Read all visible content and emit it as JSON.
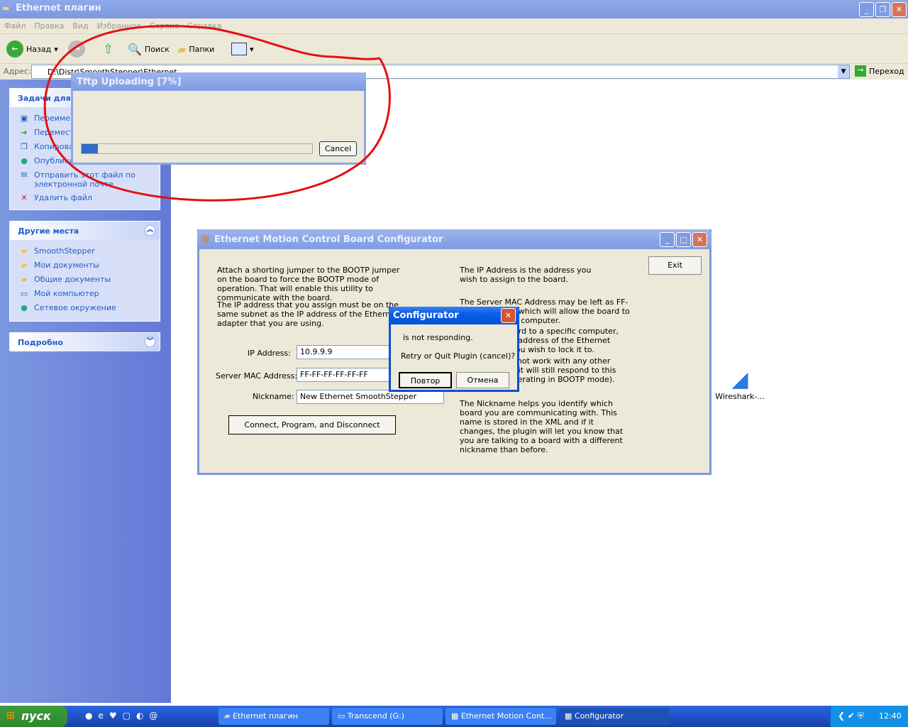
{
  "explorer": {
    "title": "Ethernet плагин",
    "menu": [
      "Файл",
      "Правка",
      "Вид",
      "Избранное",
      "Сервис",
      "Справка"
    ],
    "toolbar": {
      "back": "Назад",
      "search": "Поиск",
      "folders": "Папки"
    },
    "address_label": "Адрес:",
    "address_value": "D:\\Distr\\SmoothStepper\\Ethernet",
    "go": "Переход"
  },
  "sidebar": {
    "tasks_title": "Задачи для файла",
    "tasks": [
      "Переименовать файл",
      "Переместить файл",
      "Копировать файл",
      "Опубликовать файл в вебе",
      "Отправить этот файл по электронной почте",
      "Удалить файл"
    ],
    "places_title": "Другие места",
    "places": [
      "SmoothStepper",
      "Мои документы",
      "Общие документы",
      "Мой компьютер",
      "Сетевое окружение"
    ],
    "details_title": "Подробно"
  },
  "tftp": {
    "title": "Tftp Uploading [7%]",
    "progress_percent": 7,
    "cancel": "Cancel"
  },
  "configurator": {
    "title": "Ethernet Motion Control Board Configurator",
    "exit": "Exit",
    "text1": "Attach a shorting jumper to the BOOTP jumper on the board to force the BOOTP mode of operation.  That will enable this utility to communicate with the board.",
    "text2": "The IP address that you assign must be on the same subnet as the IP address of the Ethernet adapter that you are using.",
    "ip_label": "IP Address:",
    "ip_value": "10.9.9.9",
    "mac_label": "Server MAC Address:",
    "mac_value": "FF-FF-FF-FF-FF-FF",
    "nick_label": "Nickname:",
    "nick_value": "New Ethernet SmoothStepper",
    "connect": "Connect, Program, and Disconnect",
    "help_ip": "The IP Address is the address you wish to assign to the board.",
    "help_mac1": "The Server MAC Address may be left as FF-FF-FF-FF-FF-FF which will allow the board to respond to any computer.",
    "help_mac2": "To lock the board to a specific computer, enter the MAC address of the Ethernet adapter that you wish to lock it to.",
    "help_mac3": "The board will not work with any other computer (but it will still respond to this utility when operating in BOOTP mode).",
    "help_nick": "The Nickname helps you identify which board you are communicating with.  This name is stored in the XML and if it changes, the plugin will let you know that you are talking to a board with a different nickname than before."
  },
  "dialog": {
    "title": "Configurator",
    "line1": "is not responding.",
    "line2": "Retry or Quit Plugin (cancel)?",
    "retry": "Повтор",
    "cancel": "Отмена"
  },
  "desktop_icon": "Wireshark-...",
  "taskbar": {
    "start": "пуск",
    "tasks": [
      "Ethernet плагин",
      "Transcend (G:)",
      "Ethernet Motion Cont...",
      "Configurator"
    ],
    "clock": "12:40"
  }
}
